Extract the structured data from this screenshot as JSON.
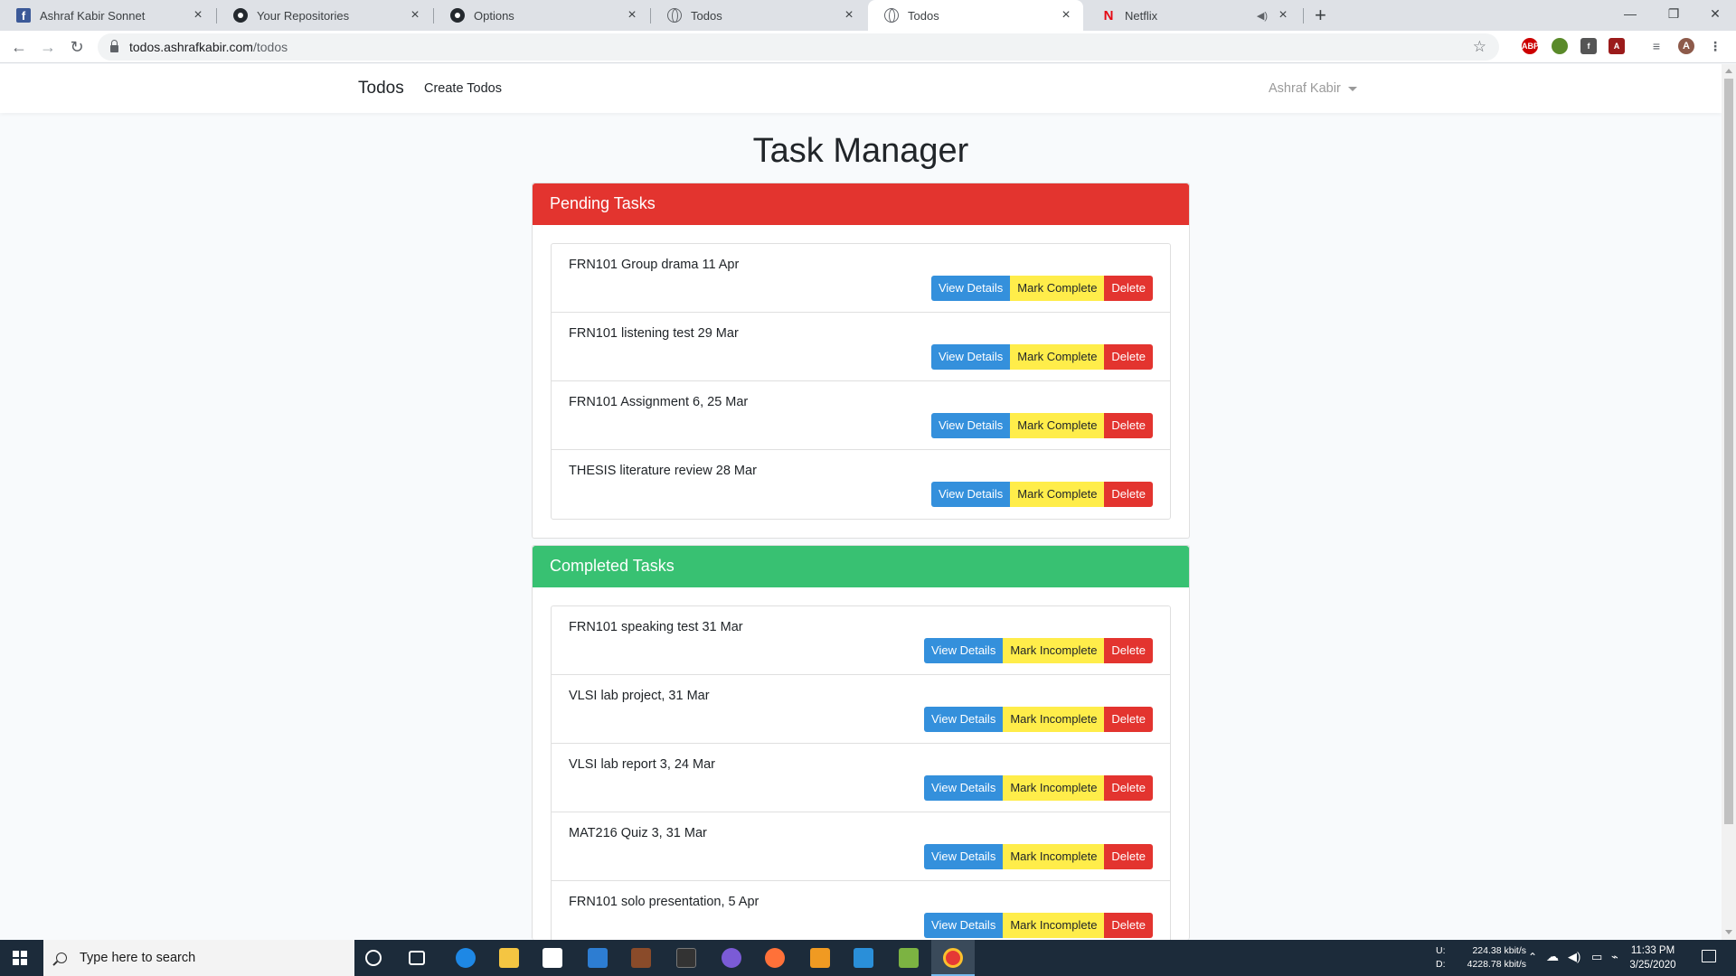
{
  "browser": {
    "tabs": [
      {
        "title": "Ashraf Kabir Sonnet",
        "favicon": "facebook-icon"
      },
      {
        "title": "Your Repositories",
        "favicon": "github-icon"
      },
      {
        "title": "Options",
        "favicon": "github-icon"
      },
      {
        "title": "Todos",
        "favicon": "globe-icon"
      },
      {
        "title": "Todos",
        "favicon": "globe-icon",
        "active": true
      },
      {
        "title": "Netflix",
        "favicon": "netflix-icon",
        "audio": true
      }
    ],
    "url_host": "todos.ashrafkabir.com",
    "url_path": "/todos"
  },
  "app": {
    "brand": "Todos",
    "nav_create": "Create Todos",
    "user_name": "Ashraf Kabir",
    "page_title": "Task Manager",
    "pending": {
      "header": "Pending Tasks",
      "color": "#e3342f",
      "tasks": [
        {
          "text": "FRN101 Group drama 11 Apr"
        },
        {
          "text": "FRN101 listening test 29 Mar"
        },
        {
          "text": "FRN101 Assignment 6, 25 Mar"
        },
        {
          "text": "THESIS literature review 28 Mar"
        }
      ],
      "buttons": {
        "view": "View Details",
        "mark": "Mark Complete",
        "delete": "Delete"
      }
    },
    "completed": {
      "header": "Completed Tasks",
      "color": "#38c172",
      "tasks": [
        {
          "text": "FRN101 speaking test 31 Mar"
        },
        {
          "text": "VLSI lab project, 31 Mar"
        },
        {
          "text": "VLSI lab report 3, 24 Mar"
        },
        {
          "text": "MAT216 Quiz 3, 31 Mar"
        },
        {
          "text": "FRN101 solo presentation, 5 Apr"
        }
      ],
      "buttons": {
        "view": "View Details",
        "mark": "Mark Incomplete",
        "delete": "Delete"
      }
    }
  },
  "taskbar": {
    "search_placeholder": "Type here to search",
    "net_up_label": "U:",
    "net_up": "224.38 kbit/s",
    "net_down_label": "D:",
    "net_down": "4228.78 kbit/s",
    "time": "11:33 PM",
    "date": "3/25/2020"
  }
}
